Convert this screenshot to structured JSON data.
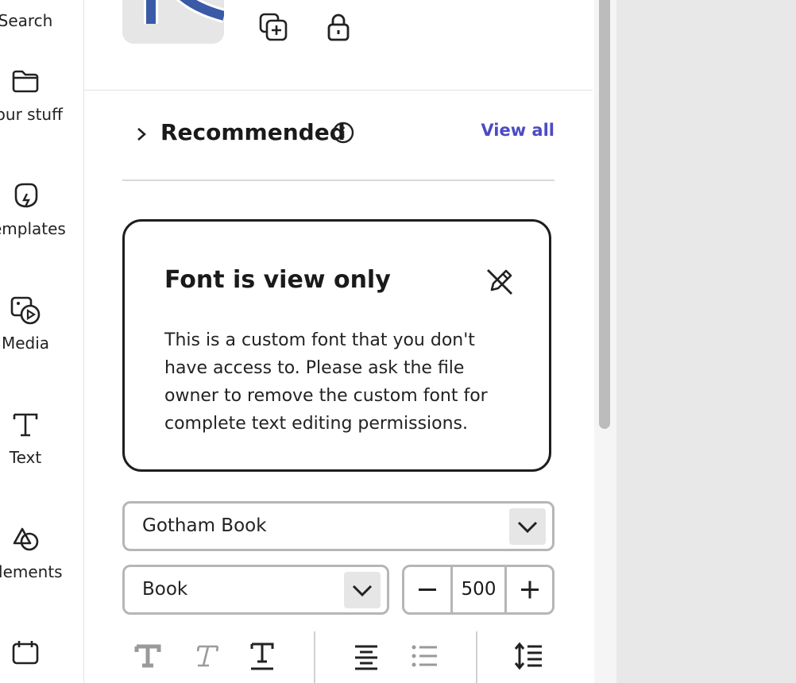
{
  "rail": {
    "items": [
      {
        "label": "Search",
        "icon": "search-icon"
      },
      {
        "label": "Your stuff",
        "icon": "folder-icon"
      },
      {
        "label": "Templates",
        "icon": "templates-icon"
      },
      {
        "label": "Media",
        "icon": "media-icon"
      },
      {
        "label": "Text",
        "icon": "text-icon"
      },
      {
        "label": "Elements",
        "icon": "elements-icon"
      },
      {
        "label": "",
        "icon": "calendar-icon"
      }
    ]
  },
  "toolbar": {
    "icons": [
      "duplicate-add-icon",
      "lock-icon"
    ]
  },
  "recommended": {
    "title": "Recommended",
    "view_all": "View all"
  },
  "notice": {
    "title": "Font is view only",
    "body": "This is a custom font that you don't have access to. Please ask the file owner to remove the custom font for complete text editing permissions.",
    "icon": "edit-disabled-icon"
  },
  "font": {
    "family": "Gotham Book",
    "weight": "Book",
    "size": "500"
  },
  "format_icons": [
    "bold-icon",
    "italic-icon",
    "underline-icon",
    "align-center-icon",
    "bullet-list-icon",
    "line-spacing-icon"
  ],
  "colors": {
    "link": "#4b4bc4",
    "border": "#b6b6b6",
    "canvas_bg": "#e8e8e8"
  }
}
